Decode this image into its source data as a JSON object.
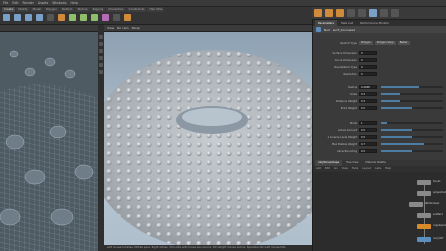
{
  "menubar": {
    "items": [
      "File",
      "Edit",
      "Render",
      "Assets",
      "Windows",
      "Help"
    ]
  },
  "shelf": {
    "tabs": [
      "Create",
      "Modify",
      "Model",
      "Polygon",
      "Deform",
      "Texture",
      "Rigging",
      "Characters",
      "Constraints",
      "Hair Utils"
    ],
    "tools": [
      "box-icon",
      "sphere-icon",
      "tube-icon",
      "torus-icon",
      "grid-icon",
      "null-icon",
      "line-icon",
      "circle-icon",
      "curve-icon",
      "path-icon",
      "spray-paint-icon",
      "font-icon"
    ]
  },
  "viewport_main": {
    "header": {
      "label": "View",
      "camera": "No cam",
      "display": "Persp"
    },
    "status": "Left mouse tumbles. Middle pans. Right dollies. Ctrl+Alt+Left mouse box-zooms. Ctrl+Right mouse zooms. Spacebar-Ctrl-Left mouse tilts."
  },
  "params": {
    "tabs": [
      "Parameters",
      "Take List",
      "Performance Monitor"
    ],
    "node_type": "Null",
    "node_name": "surfl_borrowed",
    "rows": [
      {
        "label": "Restrict Type",
        "value": "Polygon",
        "extra": [
          "Polygon Soup",
          "Bezier",
          "NURBS",
          "Polygon Mesh"
        ]
      },
      {
        "label": "Surface Dimension",
        "value": "0"
      },
      {
        "label": "Curve Dimension",
        "value": "0"
      },
      {
        "label": "Visualization Type",
        "value": "0"
      },
      {
        "label": "Resolution",
        "value": "0"
      },
      {
        "label": "",
        "value": ""
      },
      {
        "label": "Radius",
        "value": "0.4948",
        "fill": 0.62
      },
      {
        "label": "Scale",
        "value": "0.3",
        "fill": 0.3
      },
      {
        "label": "Distance Weight",
        "value": "0.3",
        "fill": 0.3
      },
      {
        "label": "Point Weight",
        "value": "0.5",
        "fill": 0.5
      },
      {
        "label": "",
        "value": ""
      },
      {
        "label": "Mode",
        "value": "1",
        "fill": 0.1
      },
      {
        "label": "Active Amount",
        "value": "0.5",
        "fill": 0.5
      },
      {
        "label": "1 Inverse Level Weight",
        "value": "0.5",
        "fill": 0.5
      },
      {
        "label": "Max Bubble Weight",
        "value": "0.7",
        "fill": 0.7
      },
      {
        "label": "Allow Bounding",
        "value": "0.5",
        "fill": 0.5
      }
    ]
  },
  "network": {
    "tabs": [
      "/obj/torus/shape",
      "Tree View",
      "Material Palette"
    ],
    "menu": [
      "Add",
      "Edit",
      "Go",
      "View",
      "Tools",
      "Layout",
      "Labs",
      "Help"
    ],
    "nodes": [
      "torus1",
      "polyextrude1",
      "attribnoise1",
      "scatter1",
      "copytopoints1",
      "null_OUT"
    ]
  },
  "colors": {
    "accent": "#5a8fbf",
    "node_active": "#d98b2a",
    "node_default": "#8a8a8a"
  }
}
